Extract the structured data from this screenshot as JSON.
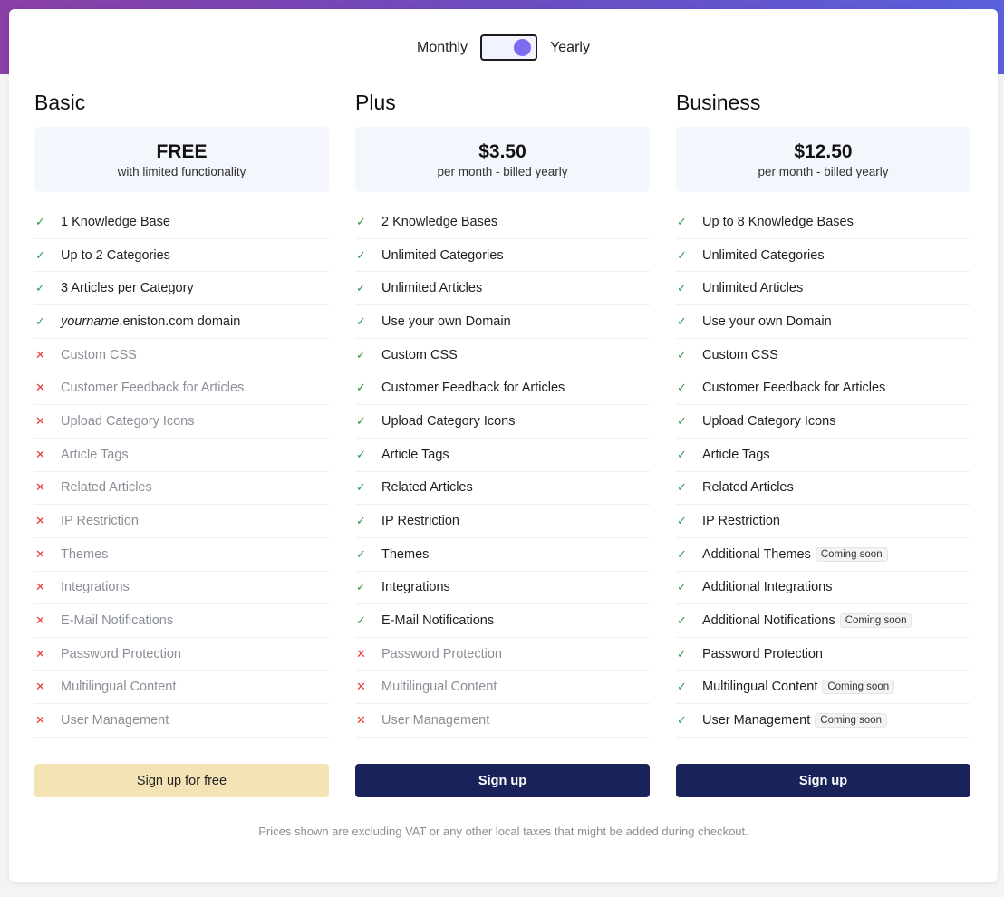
{
  "billing_toggle": {
    "left_label": "Monthly",
    "right_label": "Yearly",
    "selected": "Yearly"
  },
  "colors": {
    "toggle_knob": "#7b6cf0",
    "check": "#2e9a4a",
    "cross": "#e53935",
    "primary_button": "#1a2359",
    "free_button": "#f3e3b5",
    "price_box": "#f3f6fd"
  },
  "plans": [
    {
      "name": "Basic",
      "price": "FREE",
      "price_sub": "with limited functionality",
      "button": "Sign up for free",
      "features": [
        {
          "label": "1 Knowledge Base",
          "included": true,
          "icon": "check-icon"
        },
        {
          "label": "Up to 2 Categories",
          "included": true,
          "icon": "check-icon"
        },
        {
          "label": "3 Articles per Category",
          "included": true,
          "icon": "check-icon"
        },
        {
          "label_italic": "yourname",
          "label": ".eniston.com domain",
          "included": true,
          "icon": "check-icon"
        },
        {
          "label": "Custom CSS",
          "included": false,
          "icon": "cross-icon"
        },
        {
          "label": "Customer Feedback for Articles",
          "included": false,
          "icon": "cross-icon"
        },
        {
          "label": "Upload Category Icons",
          "included": false,
          "icon": "cross-icon"
        },
        {
          "label": "Article Tags",
          "included": false,
          "icon": "cross-icon"
        },
        {
          "label": "Related Articles",
          "included": false,
          "icon": "cross-icon"
        },
        {
          "label": "IP Restriction",
          "included": false,
          "icon": "cross-icon"
        },
        {
          "label": "Themes",
          "included": false,
          "icon": "cross-icon"
        },
        {
          "label": "Integrations",
          "included": false,
          "icon": "cross-icon"
        },
        {
          "label": "E-Mail Notifications",
          "included": false,
          "icon": "cross-icon"
        },
        {
          "label": "Password Protection",
          "included": false,
          "icon": "cross-icon"
        },
        {
          "label": "Multilingual Content",
          "included": false,
          "icon": "cross-icon"
        },
        {
          "label": "User Management",
          "included": false,
          "icon": "cross-icon"
        }
      ]
    },
    {
      "name": "Plus",
      "price": "$3.50",
      "price_sub": "per month - billed yearly",
      "button": "Sign up",
      "features": [
        {
          "label": "2 Knowledge Bases",
          "included": true,
          "icon": "check-icon"
        },
        {
          "label": "Unlimited Categories",
          "included": true,
          "icon": "check-icon"
        },
        {
          "label": "Unlimited Articles",
          "included": true,
          "icon": "check-icon"
        },
        {
          "label": "Use your own Domain",
          "included": true,
          "icon": "check-icon"
        },
        {
          "label": "Custom CSS",
          "included": true,
          "icon": "check-icon"
        },
        {
          "label": "Customer Feedback for Articles",
          "included": true,
          "icon": "check-icon"
        },
        {
          "label": "Upload Category Icons",
          "included": true,
          "icon": "check-icon"
        },
        {
          "label": "Article Tags",
          "included": true,
          "icon": "check-icon"
        },
        {
          "label": "Related Articles",
          "included": true,
          "icon": "check-icon"
        },
        {
          "label": "IP Restriction",
          "included": true,
          "icon": "check-icon"
        },
        {
          "label": "Themes",
          "included": true,
          "icon": "check-icon"
        },
        {
          "label": "Integrations",
          "included": true,
          "icon": "check-icon"
        },
        {
          "label": "E-Mail Notifications",
          "included": true,
          "icon": "check-icon"
        },
        {
          "label": "Password Protection",
          "included": false,
          "icon": "cross-icon"
        },
        {
          "label": "Multilingual Content",
          "included": false,
          "icon": "cross-icon"
        },
        {
          "label": "User Management",
          "included": false,
          "icon": "cross-icon"
        }
      ]
    },
    {
      "name": "Business",
      "price": "$12.50",
      "price_sub": "per month - billed yearly",
      "button": "Sign up",
      "features": [
        {
          "label": "Up to 8 Knowledge Bases",
          "included": true,
          "icon": "check-icon"
        },
        {
          "label": "Unlimited Categories",
          "included": true,
          "icon": "check-icon"
        },
        {
          "label": "Unlimited Articles",
          "included": true,
          "icon": "check-icon"
        },
        {
          "label": "Use your own Domain",
          "included": true,
          "icon": "check-icon"
        },
        {
          "label": "Custom CSS",
          "included": true,
          "icon": "check-icon"
        },
        {
          "label": "Customer Feedback for Articles",
          "included": true,
          "icon": "check-icon"
        },
        {
          "label": "Upload Category Icons",
          "included": true,
          "icon": "check-icon"
        },
        {
          "label": "Article Tags",
          "included": true,
          "icon": "check-icon"
        },
        {
          "label": "Related Articles",
          "included": true,
          "icon": "check-icon"
        },
        {
          "label": "IP Restriction",
          "included": true,
          "icon": "check-icon"
        },
        {
          "label": "Additional Themes",
          "badge": "Coming soon",
          "included": true,
          "icon": "check-icon"
        },
        {
          "label": "Additional Integrations",
          "included": true,
          "icon": "check-icon"
        },
        {
          "label": "Additional Notifications",
          "badge": "Coming soon",
          "included": true,
          "icon": "check-icon"
        },
        {
          "label": "Password Protection",
          "included": true,
          "icon": "check-icon"
        },
        {
          "label": "Multilingual Content",
          "badge": "Coming soon",
          "included": true,
          "icon": "check-icon"
        },
        {
          "label": "User Management",
          "badge": "Coming soon",
          "included": true,
          "icon": "check-icon"
        }
      ]
    }
  ],
  "footnote": "Prices shown are excluding VAT or any other local taxes that might be added during checkout."
}
